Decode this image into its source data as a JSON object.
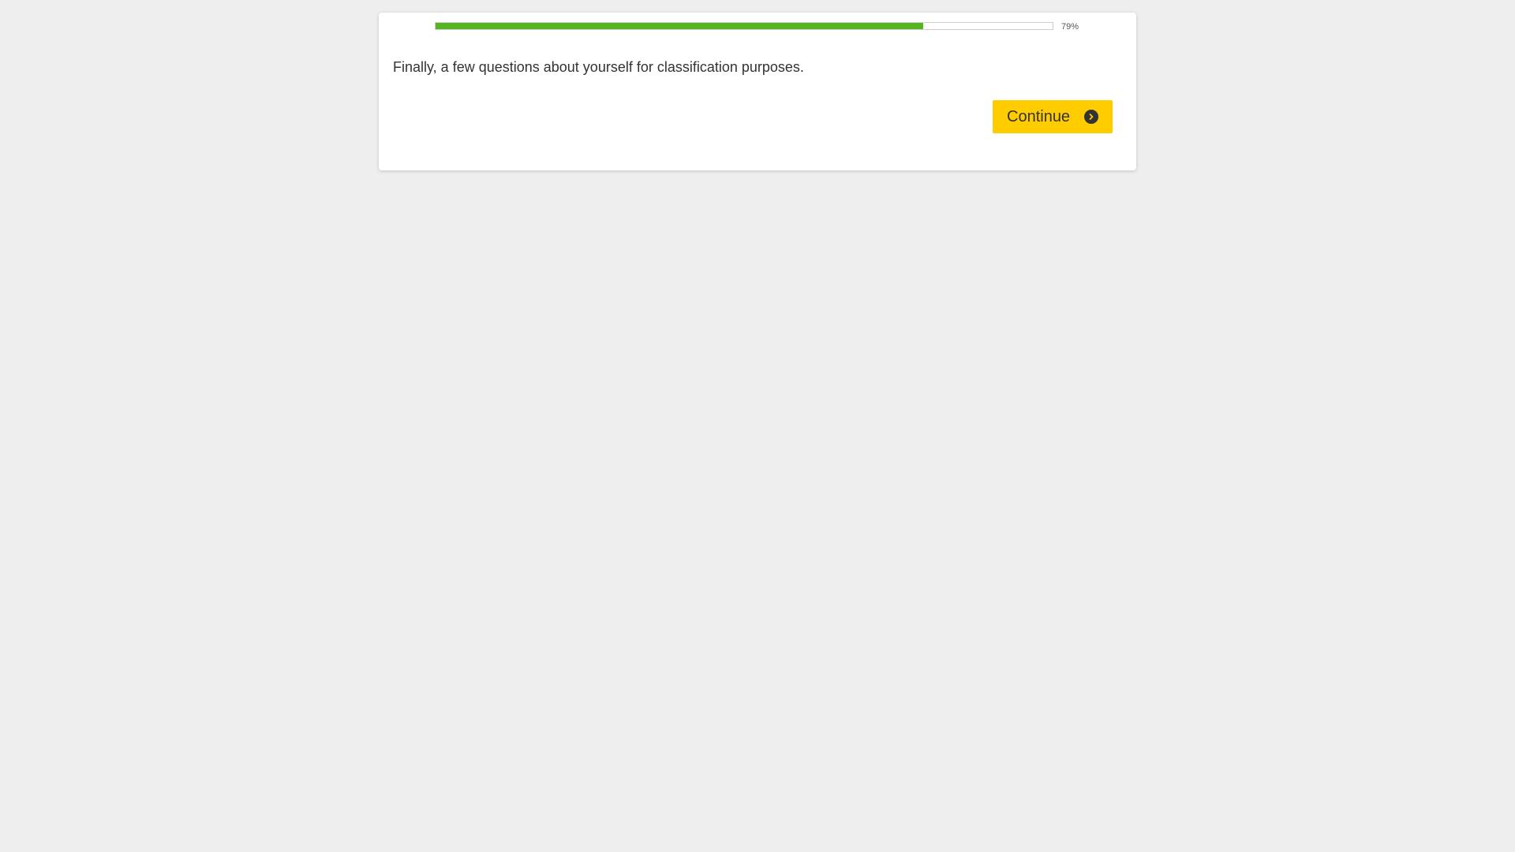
{
  "survey": {
    "progress": {
      "fraction": 0.79,
      "label": "79%",
      "fill_color": "#55b51e"
    },
    "intro_text": "Finally, a few questions about yourself for classification purposes.",
    "continue_button": {
      "label": "Continue",
      "icon": "chevron-right-circle-icon",
      "color": "#ffcc00"
    }
  }
}
